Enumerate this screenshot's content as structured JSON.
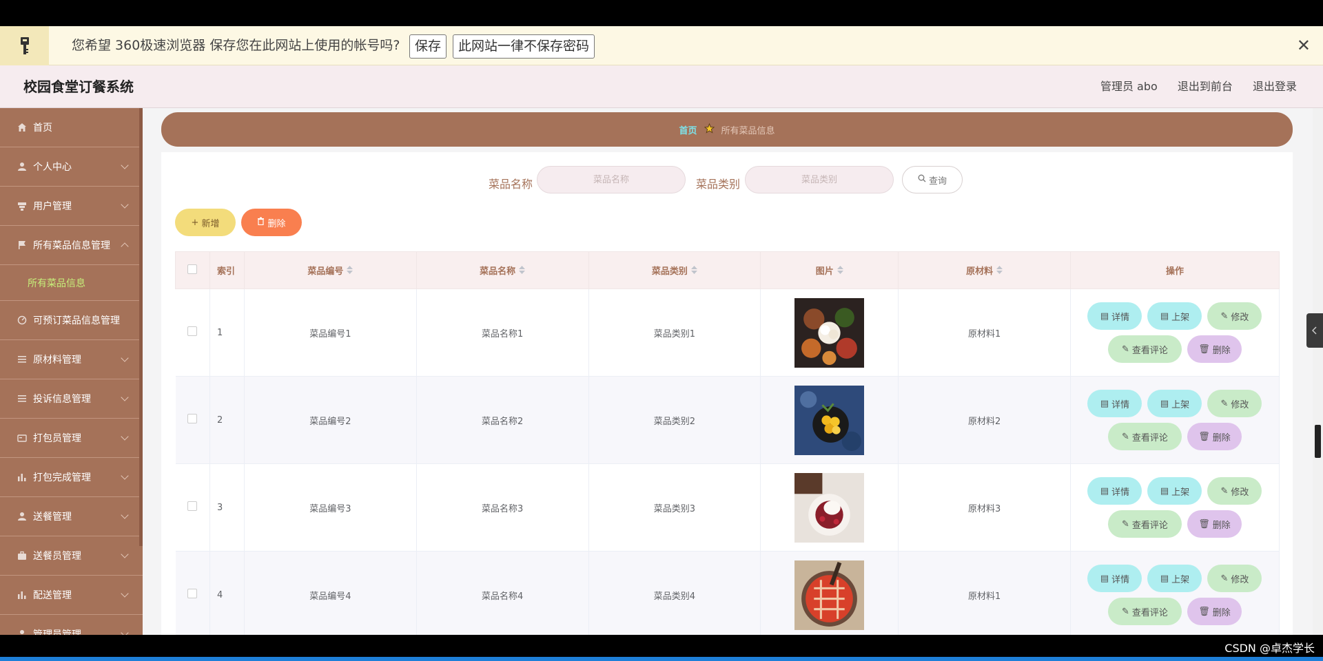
{
  "password_bar": {
    "message": "您希望 360极速浏览器 保存您在此网站上使用的帐号吗?",
    "save_label": "保存",
    "never_label": "此网站一律不保存密码",
    "close_label": "✕"
  },
  "header": {
    "app_title": "校园食堂订餐系统",
    "admin_label": "管理员 abo",
    "to_front_label": "退出到前台",
    "logout_label": "退出登录"
  },
  "sidebar": {
    "items": [
      {
        "label": "首页",
        "icon": "home-icon"
      },
      {
        "label": "个人中心",
        "icon": "user-icon"
      },
      {
        "label": "用户管理",
        "icon": "users-icon"
      },
      {
        "label": "所有菜品信息管理",
        "icon": "flag-icon",
        "expanded": true,
        "sub": "所有菜品信息"
      },
      {
        "label": "可预订菜品信息管理",
        "icon": "gauge-icon"
      },
      {
        "label": "原材料管理",
        "icon": "list-icon"
      },
      {
        "label": "投诉信息管理",
        "icon": "list-icon"
      },
      {
        "label": "打包员管理",
        "icon": "card-icon"
      },
      {
        "label": "打包完成管理",
        "icon": "bar-chart-icon"
      },
      {
        "label": "送餐管理",
        "icon": "user-icon"
      },
      {
        "label": "送餐员管理",
        "icon": "briefcase-icon"
      },
      {
        "label": "配送管理",
        "icon": "bar-chart-icon"
      },
      {
        "label": "管理员管理",
        "icon": "user-icon"
      }
    ]
  },
  "breadcrumb": {
    "home": "首页",
    "current": "所有菜品信息"
  },
  "search": {
    "name_label": "菜品名称",
    "name_placeholder": "菜品名称",
    "type_label": "菜品类别",
    "type_placeholder": "菜品类别",
    "query_label": "查询"
  },
  "actions": {
    "add_label": "新增",
    "delete_label": "删除"
  },
  "table": {
    "headers": [
      "索引",
      "菜品编号",
      "菜品名称",
      "菜品类别",
      "图片",
      "原材料",
      "操作"
    ],
    "rows": [
      {
        "index": "1",
        "code": "菜品编号1",
        "name": "菜品名称1",
        "type": "菜品类别1",
        "material": "原材料1"
      },
      {
        "index": "2",
        "code": "菜品编号2",
        "name": "菜品名称2",
        "type": "菜品类别2",
        "material": "原材料2"
      },
      {
        "index": "3",
        "code": "菜品编号3",
        "name": "菜品名称3",
        "type": "菜品类别3",
        "material": "原材料3"
      },
      {
        "index": "4",
        "code": "菜品编号4",
        "name": "菜品名称4",
        "type": "菜品类别4",
        "material": "原材料1"
      }
    ],
    "op_labels": {
      "detail": "详情",
      "shelf": "上架",
      "edit": "修改",
      "review": "查看评论",
      "delete": "删除"
    }
  },
  "watermark": "CSDN @卓杰学长",
  "colors": {
    "sidebar_bg": "#a57259",
    "accent_green": "#c6ef7a",
    "add_button": "#f3dc7b",
    "delete_button": "#f97f4f"
  }
}
